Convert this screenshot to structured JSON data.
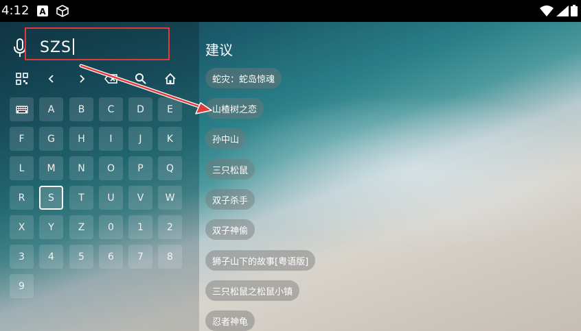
{
  "status_bar": {
    "time": "4:12",
    "icons": [
      "font-a-icon",
      "cube-icon",
      "wifi-icon",
      "battery-icon"
    ]
  },
  "search": {
    "query": "SZS",
    "mic_icon": "mic-icon"
  },
  "suggestions": {
    "title": "建议",
    "items": [
      "蛇灾：蛇岛惊魂",
      "山楂树之恋",
      "孙中山",
      "三只松鼠",
      "双子杀手",
      "双子神偷",
      "狮子山下的故事[粤语版]",
      "三只松鼠之松鼠小镇",
      "忍者神龟"
    ]
  },
  "keyboard": {
    "tools": [
      "qr-code-icon",
      "chevron-left-icon",
      "chevron-right-icon",
      "backspace-icon",
      "search-icon",
      "home-icon"
    ],
    "rows": [
      [
        "keyboard-icon",
        "A",
        "B",
        "C",
        "D",
        "E"
      ],
      [
        "F",
        "G",
        "H",
        "I",
        "J",
        "K"
      ],
      [
        "L",
        "M",
        "N",
        "O",
        "P",
        "Q"
      ],
      [
        "R",
        "S",
        "T",
        "U",
        "V",
        "W"
      ],
      [
        "X",
        "Y",
        "Z",
        "0",
        "1",
        "2"
      ],
      [
        "3",
        "4",
        "5",
        "6",
        "7",
        "8"
      ],
      [
        "9"
      ]
    ],
    "focused_key": "S"
  },
  "annotation": {
    "highlight_color": "#e23a3a"
  }
}
